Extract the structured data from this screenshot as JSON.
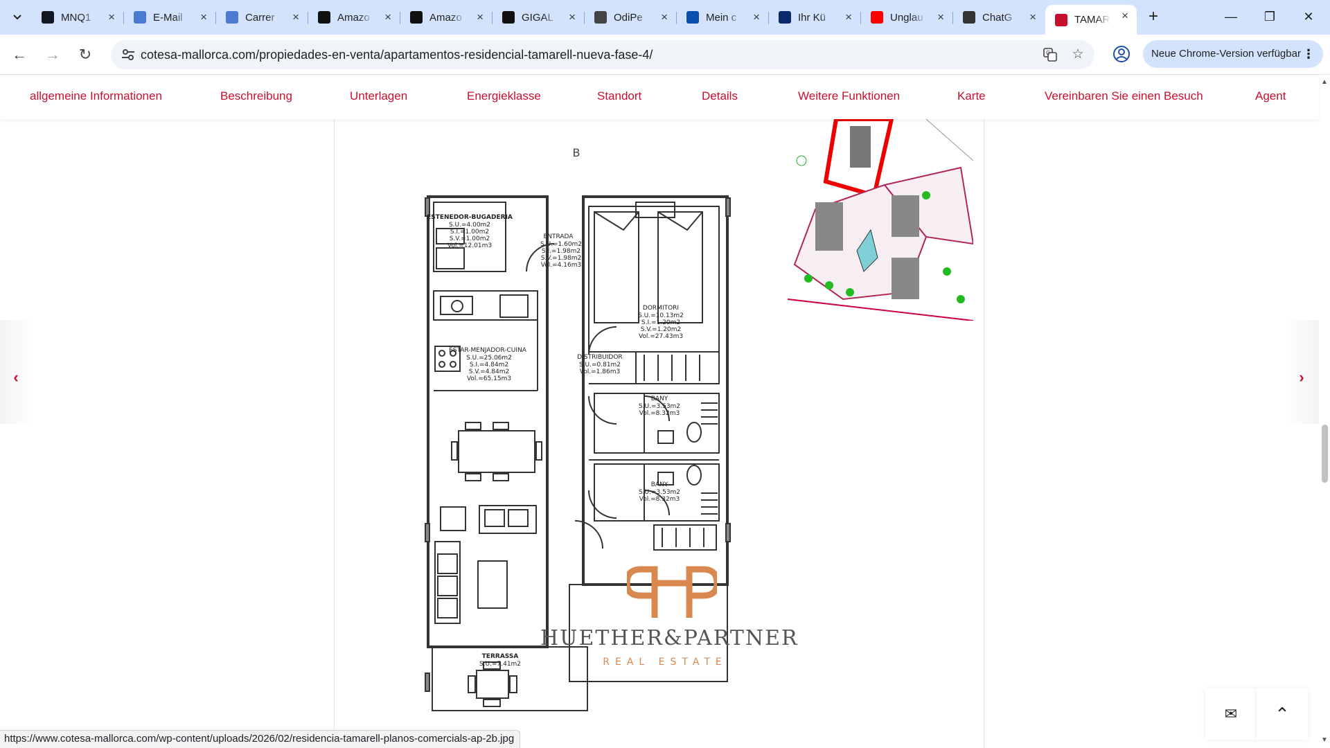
{
  "browser": {
    "tabs": [
      {
        "title": "MNQ1",
        "icon": "tradingview-icon",
        "color": "#131722"
      },
      {
        "title": "E-Mail",
        "icon": "loading-icon",
        "color": "#4a7bd0"
      },
      {
        "title": "Carrer",
        "icon": "loading-icon",
        "color": "#4a7bd0"
      },
      {
        "title": "Amazo",
        "icon": "amazon-icon",
        "color": "#111111"
      },
      {
        "title": "Amazo",
        "icon": "amazon-icon",
        "color": "#111111"
      },
      {
        "title": "GIGAL",
        "icon": "amazon-icon",
        "color": "#111111"
      },
      {
        "title": "OdiPe",
        "icon": "globe-icon",
        "color": "#444444"
      },
      {
        "title": "Mein c",
        "icon": "o2-icon",
        "color": "#0a4fad"
      },
      {
        "title": "Ihr Kü",
        "icon": "o2-icon",
        "color": "#0a2a6b"
      },
      {
        "title": "Unglau",
        "icon": "youtube-icon",
        "color": "#ff0000"
      },
      {
        "title": "ChatG",
        "icon": "chatgpt-icon",
        "color": "#333333"
      },
      {
        "title": "TAMAR",
        "icon": "cotesa-icon",
        "color": "#c8102e",
        "active": true
      }
    ],
    "url_host": "cotesa-mallorca.com",
    "url_path": "/propiedades-en-venta/apartamentos-residencial-tamarell-nueva-fase-4/",
    "update_label": "Neue Chrome-Version verfügbar",
    "status_url": "https://www.cotesa-mallorca.com/wp-content/uploads/2026/02/residencia-tamarell-planos-comercials-ap-2b.jpg"
  },
  "page_nav": [
    "allgemeine Informationen",
    "Beschreibung",
    "Unterlagen",
    "Energieklasse",
    "Standort",
    "Details",
    "Weitere Funktionen",
    "Karte",
    "Vereinbaren Sie einen Besuch",
    "Agent"
  ],
  "floor_plan": {
    "block_label": "B",
    "rooms": [
      {
        "name": "ESTENEDOR-BUGADERIA",
        "lines": [
          "S.U.=4.00m2",
          "S.I.=1.00m2",
          "S.V.=1.00m2",
          "Vol.=12.01m3"
        ]
      },
      {
        "name": "ENTRADA",
        "lines": [
          "S.U.=1.60m2",
          "S.I.=1.98m2",
          "S.V.=1.98m2",
          "Vol.=4.16m3"
        ]
      },
      {
        "name": "DORMITORI",
        "lines": [
          "S.U.=10.13m2",
          "S.I.=1.20m2",
          "S.V.=1.20m2",
          "Vol.=27.43m3"
        ]
      },
      {
        "name": "ESTAR-MENJADOR-CUINA",
        "lines": [
          "S.U.=25.06m2",
          "S.I.=4.84m2",
          "S.V.=4.84m2",
          "Vol.=65.15m3"
        ]
      },
      {
        "name": "DISTRIBUIDOR",
        "lines": [
          "S.U.=0.81m2",
          "Vol.=1.86m3"
        ]
      },
      {
        "name": "BANY",
        "lines": [
          "S.U.=3.53m2",
          "Vol.=8.32m3"
        ]
      },
      {
        "name": "BANY",
        "lines": [
          "S.U.=3.53m2",
          "Vol.=8.32m3"
        ]
      },
      {
        "name": "TERRASSA",
        "lines": [
          "S.U.=7.41m2"
        ]
      }
    ]
  },
  "watermark": {
    "name": "HUETHER&PARTNER",
    "subtitle": "REAL ESTATE",
    "accent": "#d9894f"
  },
  "colors": {
    "brand_red": "#c8102e",
    "tabstrip": "#d3e3fd"
  }
}
